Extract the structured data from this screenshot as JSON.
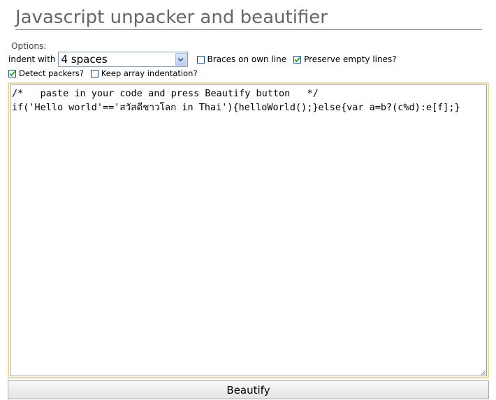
{
  "header": {
    "title": "Javascript unpacker and beautifier"
  },
  "options": {
    "legend": "Options:",
    "indent_label": "indent with",
    "indent_select": {
      "value": "4 spaces",
      "icon": "chevron-down-icon"
    },
    "braces_on_own_line": {
      "label": "Braces on own line",
      "checked": false
    },
    "preserve_empty_lines": {
      "label": "Preserve empty lines?",
      "checked": true
    },
    "detect_packers": {
      "label": "Detect packers?",
      "checked": true
    },
    "keep_array_indentation": {
      "label": "Keep array indentation?",
      "checked": false
    }
  },
  "editor": {
    "code": "/*   paste in your code and press Beautify button   */\nif('Hello world'=='สวัสดีชาวโลก in Thai'){helloWorld();}else{var a=b?(c%d):e[f];}"
  },
  "actions": {
    "beautify_label": "Beautify"
  },
  "colors": {
    "title": "#666666",
    "textarea_border": "#e8d9a6",
    "checkmark": "#21a121"
  }
}
